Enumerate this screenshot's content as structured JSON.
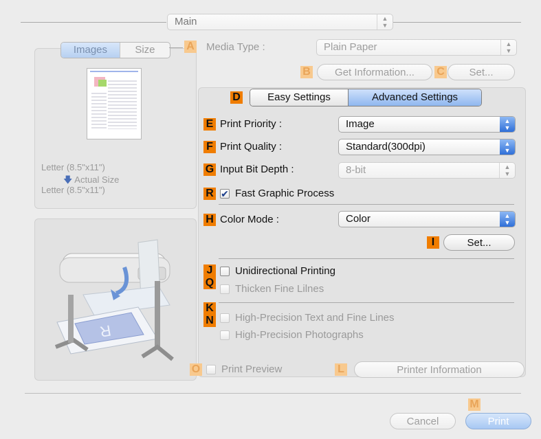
{
  "top_select": {
    "value": "Main"
  },
  "preview_tabs": [
    {
      "label": "Images",
      "active": true
    },
    {
      "label": "Size",
      "active": false
    }
  ],
  "paper_info": {
    "line1": "Letter (8.5\"x11\")",
    "line2": "Actual Size",
    "line3": "Letter (8.5\"x11\")"
  },
  "media_type": {
    "badge": "A",
    "label": "Media Type :",
    "value": "Plain Paper"
  },
  "get_info": {
    "badge": "B",
    "label": "Get Information..."
  },
  "set_top": {
    "badge": "C",
    "label": "Set..."
  },
  "settings_tabs": {
    "badge": "D",
    "easy": "Easy Settings",
    "advanced": "Advanced Settings",
    "active": "advanced"
  },
  "print_priority": {
    "badge": "E",
    "label": "Print Priority :",
    "value": "Image"
  },
  "print_quality": {
    "badge": "F",
    "label": "Print Quality :",
    "value": "Standard(300dpi)"
  },
  "input_bit_depth": {
    "badge": "G",
    "label": "Input Bit Depth :",
    "value": "8-bit"
  },
  "fast_graphic": {
    "badge": "R",
    "label": "Fast Graphic Process",
    "checked": true
  },
  "color_mode": {
    "badge": "H",
    "label": "Color Mode :",
    "value": "Color"
  },
  "color_set": {
    "badge": "I",
    "label": "Set..."
  },
  "unidirectional": {
    "badge": "J",
    "label": "Unidirectional Printing",
    "checked": false
  },
  "thicken": {
    "badge": "Q",
    "label": "Thicken Fine Lilnes",
    "checked": false
  },
  "hp_text": {
    "badge": "K",
    "label": "High-Precision Text and Fine Lines",
    "checked": false
  },
  "hp_photo": {
    "badge": "N",
    "label": "High-Precision Photographs",
    "checked": false
  },
  "print_preview": {
    "badge": "O",
    "label": "Print Preview",
    "checked": false
  },
  "printer_info": {
    "badge": "L",
    "label": "Printer Information"
  },
  "footer": {
    "badge": "M",
    "cancel": "Cancel",
    "print": "Print"
  },
  "colors": {
    "badge": "#f07d00",
    "accent": "#2f6fd8"
  },
  "icons": {
    "select_arrows": "updown-arrows-icon",
    "paper": "paper-thumbnail-icon",
    "printer": "large-format-printer-icon",
    "actual_size": "down-arrow-icon"
  }
}
